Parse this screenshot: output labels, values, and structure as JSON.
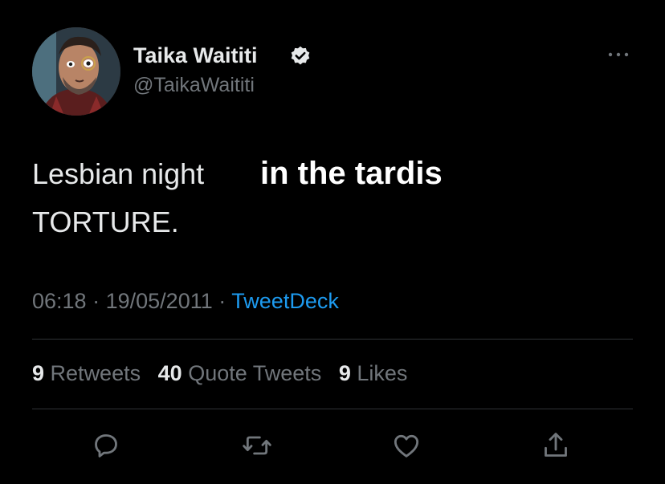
{
  "user": {
    "display_name": "Taika Waititi",
    "handle": "@TaikaWaititi",
    "verified": true,
    "avatar_icon": "avatar-photo"
  },
  "tweet": {
    "text_part1": "Lesbian night",
    "text_overlay": "in the tardis",
    "text_part2": "TORTURE.",
    "time": "06:18",
    "separator1": "·",
    "date": "19/05/2011",
    "separator2": "·",
    "source": "TweetDeck"
  },
  "stats": {
    "retweets_count": "9",
    "retweets_label": "Retweets",
    "quotes_count": "40",
    "quotes_label": "Quote Tweets",
    "likes_count": "9",
    "likes_label": "Likes"
  },
  "actions": [
    "reply-icon",
    "retweet-icon",
    "like-icon",
    "share-icon"
  ],
  "colors": {
    "background": "#000000",
    "text": "#e7e9ea",
    "secondary": "#71767b",
    "link": "#1d9bf0",
    "divider": "#2f3336"
  }
}
